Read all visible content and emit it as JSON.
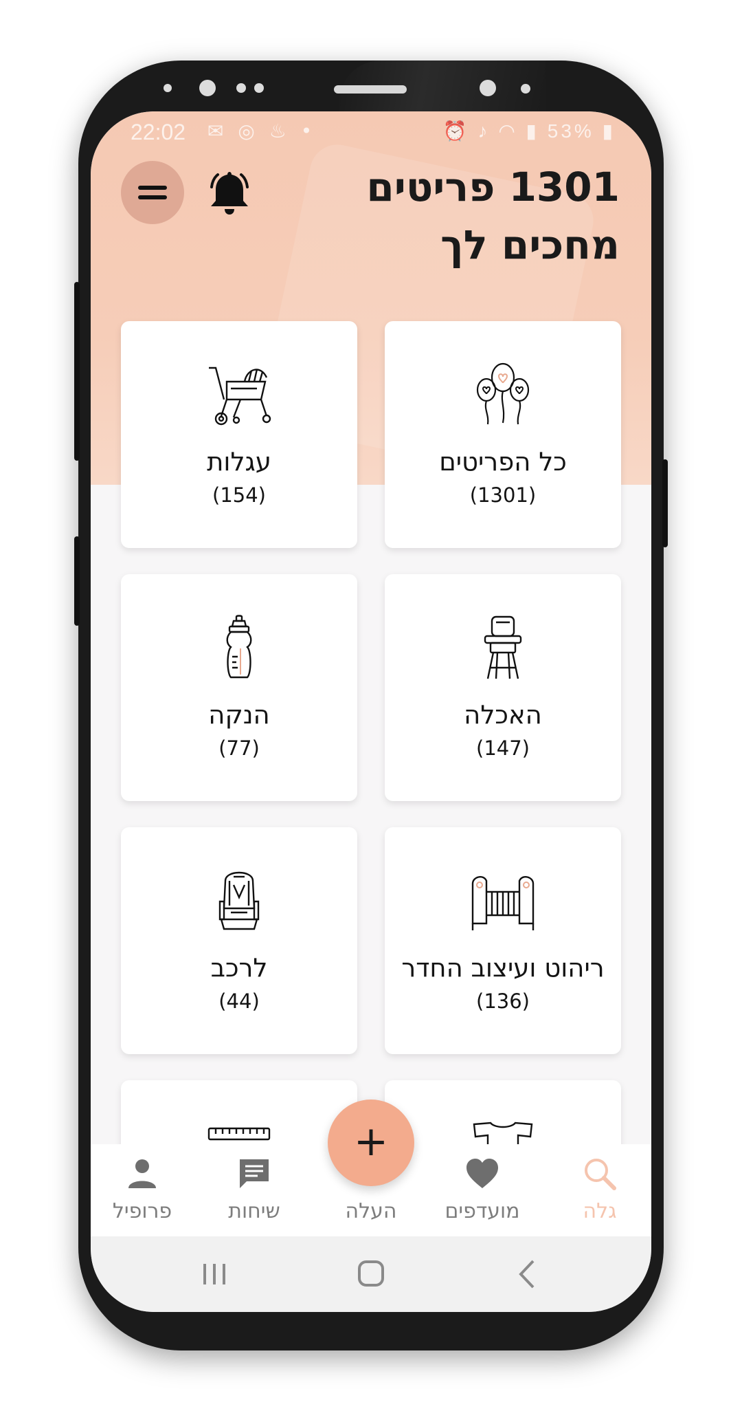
{
  "status_bar": {
    "time": "22:02",
    "battery": "53%",
    "left_icons": [
      "gmail-icon",
      "whatsapp-icon",
      "notification-icon",
      "dot-icon"
    ],
    "right_icons": [
      "alarm-icon",
      "mute-icon",
      "wifi-icon",
      "signal-icon",
      "battery-icon"
    ]
  },
  "header": {
    "title_line1": "1301 פריטים",
    "title_line2": "מחכים לך",
    "menu_icon": "menu-icon",
    "bell_icon": "bell-icon"
  },
  "categories": [
    {
      "label": "כל הפריטים",
      "count": "(1301)",
      "icon": "balloons-icon"
    },
    {
      "label": "עגלות",
      "count": "(154)",
      "icon": "stroller-icon"
    },
    {
      "label": "האכלה",
      "count": "(147)",
      "icon": "high-chair-icon"
    },
    {
      "label": "הנקה",
      "count": "(77)",
      "icon": "baby-bottle-icon"
    },
    {
      "label": "ריהוט ועיצוב החדר",
      "count": "(136)",
      "icon": "crib-icon"
    },
    {
      "label": "לרכב",
      "count": "(44)",
      "icon": "car-seat-icon"
    }
  ],
  "bottom_nav": {
    "items": [
      {
        "label": "פרופיל",
        "icon": "person-icon"
      },
      {
        "label": "שיחות",
        "icon": "chat-icon"
      },
      {
        "label": "העלה",
        "icon": "plus-icon"
      },
      {
        "label": "מועדפים",
        "icon": "heart-icon"
      },
      {
        "label": "גלה",
        "icon": "search-icon"
      }
    ],
    "active": "גלה",
    "fab_symbol": "+"
  },
  "colors": {
    "header": "#f5c9b3",
    "fab": "#f3ab8d",
    "active_nav": "#f5c4ae",
    "menu_button": "#dfa995"
  }
}
